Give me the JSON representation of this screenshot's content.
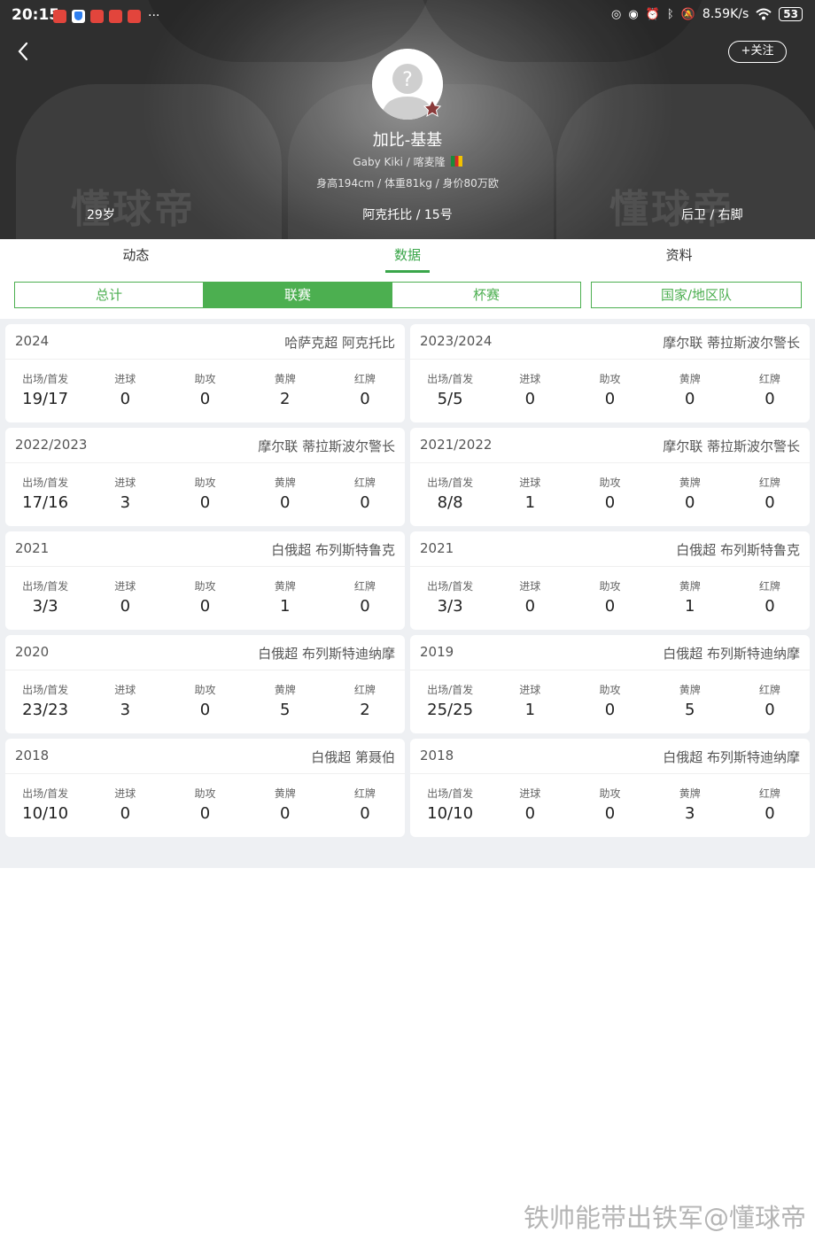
{
  "status_bar": {
    "time": "20:15",
    "network_speed": "8.59K/s",
    "battery": "53"
  },
  "header": {
    "follow_label": "+关注",
    "name": "加比-基基",
    "subline": "Gaby Kiki / 喀麦隆",
    "stats_line": "身高194cm / 体重81kg / 身价80万欧",
    "age": "29岁",
    "team_line": "阿克托比 / 15号",
    "position": "后卫 / 右脚",
    "watermark": "懂球帝"
  },
  "tabs": [
    {
      "label": "动态",
      "active": false
    },
    {
      "label": "数据",
      "active": true
    },
    {
      "label": "资料",
      "active": false
    }
  ],
  "segments": {
    "main": [
      {
        "label": "总计",
        "active": false
      },
      {
        "label": "联赛",
        "active": true
      },
      {
        "label": "杯赛",
        "active": false
      }
    ],
    "national": {
      "label": "国家/地区队"
    }
  },
  "stat_labels": [
    "出场/首发",
    "进球",
    "助攻",
    "黄牌",
    "红牌"
  ],
  "seasons": [
    {
      "season": "2024",
      "league": "哈萨克超 阿克托比",
      "values": [
        "19/17",
        "0",
        "0",
        "2",
        "0"
      ]
    },
    {
      "season": "2023/2024",
      "league": "摩尔联 蒂拉斯波尔警长",
      "values": [
        "5/5",
        "0",
        "0",
        "0",
        "0"
      ]
    },
    {
      "season": "2022/2023",
      "league": "摩尔联 蒂拉斯波尔警长",
      "values": [
        "17/16",
        "3",
        "0",
        "0",
        "0"
      ]
    },
    {
      "season": "2021/2022",
      "league": "摩尔联 蒂拉斯波尔警长",
      "values": [
        "8/8",
        "1",
        "0",
        "0",
        "0"
      ]
    },
    {
      "season": "2021",
      "league": "白俄超 布列斯特鲁克",
      "values": [
        "3/3",
        "0",
        "0",
        "1",
        "0"
      ]
    },
    {
      "season": "2021",
      "league": "白俄超 布列斯特鲁克",
      "values": [
        "3/3",
        "0",
        "0",
        "1",
        "0"
      ]
    },
    {
      "season": "2020",
      "league": "白俄超 布列斯特迪纳摩",
      "values": [
        "23/23",
        "3",
        "0",
        "5",
        "2"
      ]
    },
    {
      "season": "2019",
      "league": "白俄超 布列斯特迪纳摩",
      "values": [
        "25/25",
        "1",
        "0",
        "5",
        "0"
      ]
    },
    {
      "season": "2018",
      "league": "白俄超 第聂伯",
      "values": [
        "10/10",
        "0",
        "0",
        "0",
        "0"
      ]
    },
    {
      "season": "2018",
      "league": "白俄超 布列斯特迪纳摩",
      "values": [
        "10/10",
        "0",
        "0",
        "3",
        "0"
      ]
    }
  ],
  "footer_watermark": "铁帅能带出铁军@懂球帝",
  "colors": {
    "accent": "#4caf50"
  }
}
